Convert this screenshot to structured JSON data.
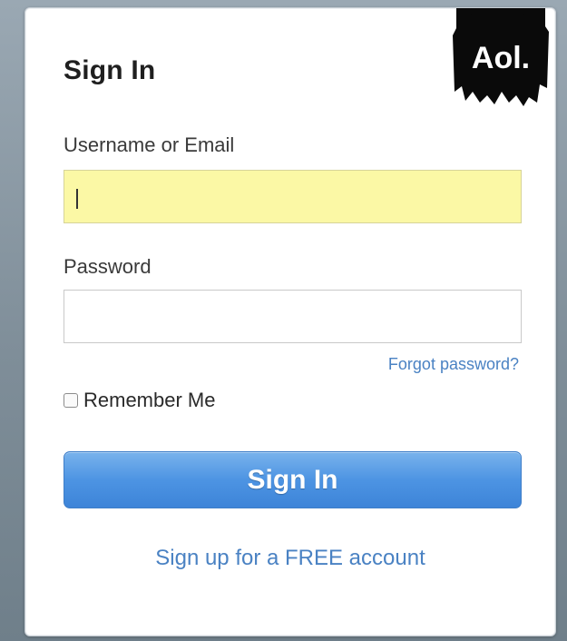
{
  "form": {
    "title": "Sign In",
    "logo_text": "Aol.",
    "username_label": "Username or Email",
    "username_value": "",
    "password_label": "Password",
    "password_value": "",
    "forgot_password": "Forgot password?",
    "remember_me": "Remember Me",
    "remember_me_checked": false,
    "sign_in_button": "Sign In",
    "signup_link": "Sign up for a FREE account"
  },
  "colors": {
    "accent": "#4a90e2",
    "link": "#4a82c3",
    "autofill": "#fbf8a5"
  }
}
